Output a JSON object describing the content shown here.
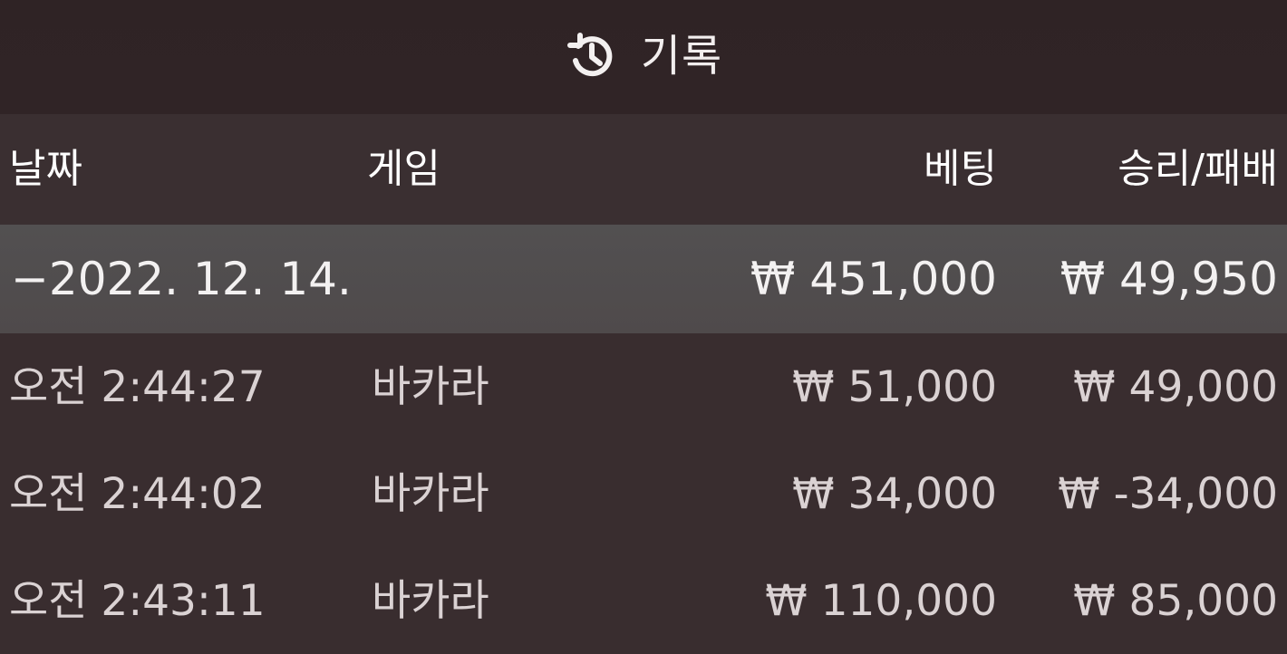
{
  "header": {
    "icon": "history-icon",
    "title": "기록"
  },
  "table": {
    "columns": {
      "date": "날짜",
      "game": "게임",
      "bet": "베팅",
      "result": "승리/패배"
    },
    "summary": {
      "date": "−2022. 12. 14.",
      "bet": "₩ 451,000",
      "result": "₩ 49,950"
    },
    "rows": [
      {
        "date": "오전 2:44:27",
        "game": "바카라",
        "bet": "₩ 51,000",
        "result": "₩ 49,000"
      },
      {
        "date": "오전 2:44:02",
        "game": "바카라",
        "bet": "₩ 34,000",
        "result": "₩ -34,000"
      },
      {
        "date": "오전 2:43:11",
        "game": "바카라",
        "bet": "₩ 110,000",
        "result": "₩ 85,000"
      }
    ]
  }
}
